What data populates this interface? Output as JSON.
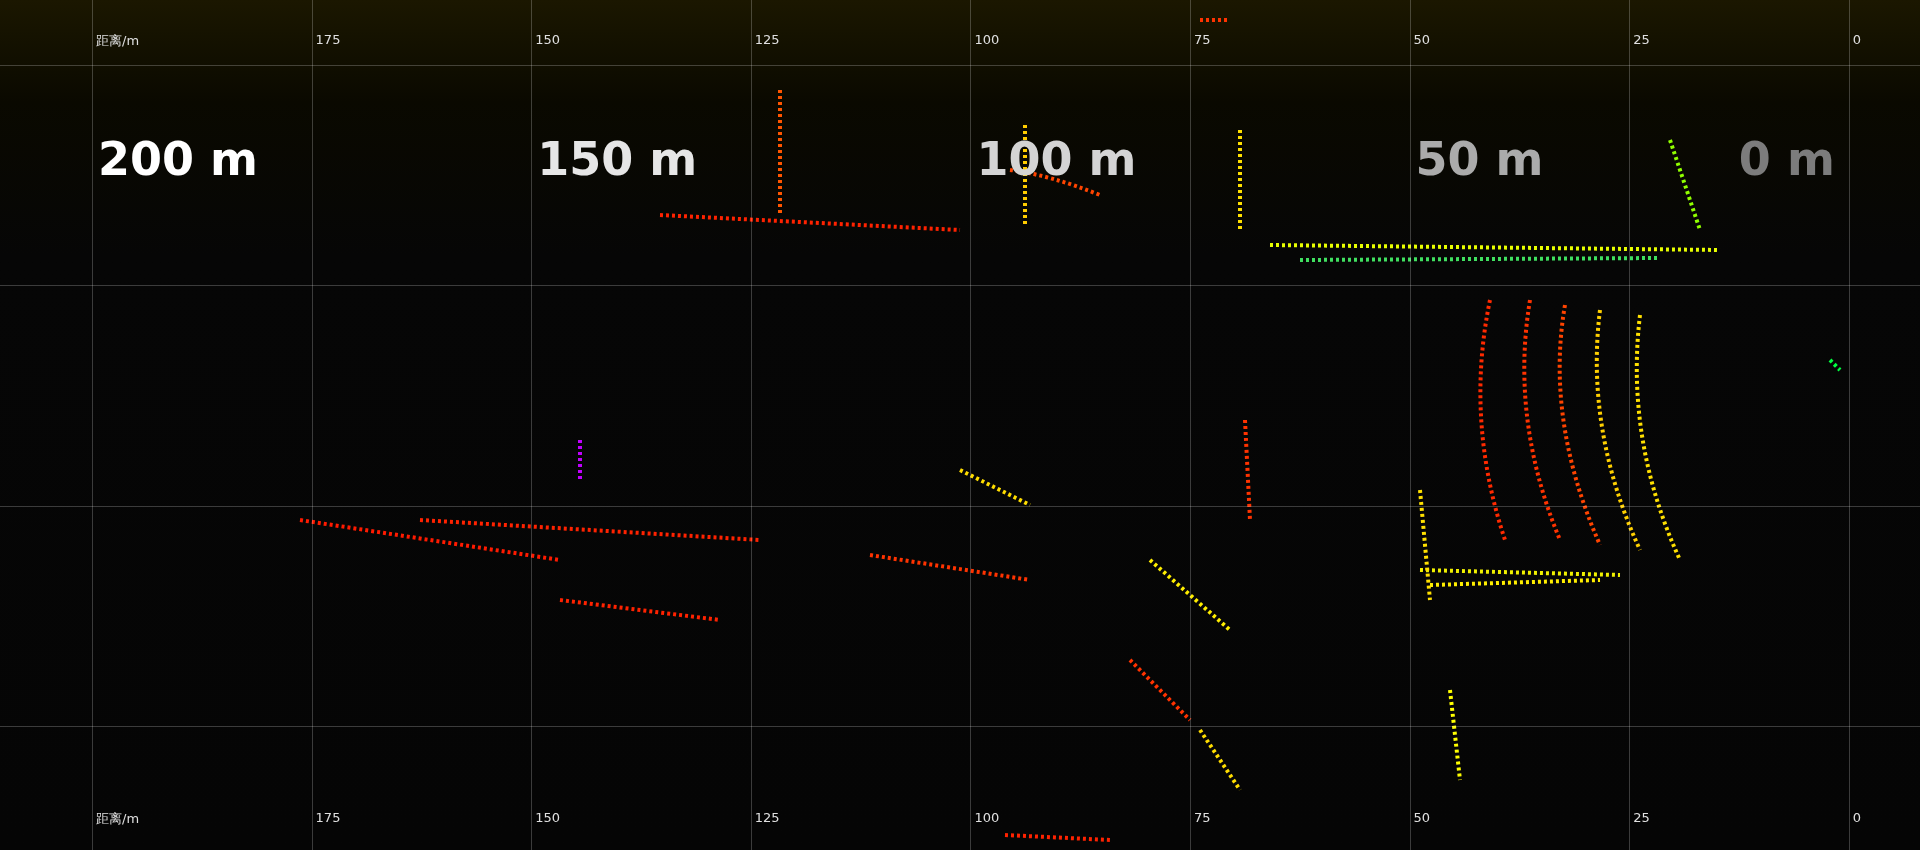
{
  "top_axis": {
    "unit_label": "距离/m",
    "ticks": [
      "175",
      "150",
      "125",
      "100",
      "75",
      "50",
      "25",
      "0"
    ]
  },
  "distance_labels": [
    {
      "text": "200 m",
      "color": "#ffffff"
    },
    {
      "text": "150 m",
      "color": "#e6e6e6"
    },
    {
      "text": "100 m",
      "color": "#d4d4d4"
    },
    {
      "text": "50 m",
      "color": "#ababab"
    },
    {
      "text": "0 m",
      "color": "#7c7c7c"
    }
  ],
  "bottom_axis": {
    "unit_label": "距离/m",
    "ticks": [
      "175",
      "150",
      "125",
      "100",
      "75",
      "50",
      "25",
      "0"
    ]
  }
}
